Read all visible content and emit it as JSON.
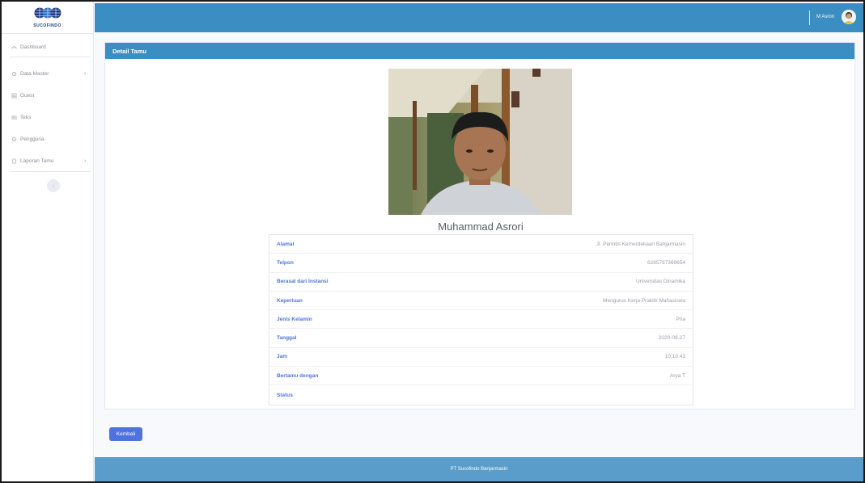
{
  "brand": {
    "logo_text": "SUCOFINDO"
  },
  "sidebar": {
    "items": [
      {
        "label": "Dashboard",
        "icon": "gauge-icon"
      },
      {
        "label": "Data Master",
        "icon": "cog-icon",
        "has_submenu": true
      },
      {
        "label": "Guest",
        "icon": "table-icon"
      },
      {
        "label": "Teks",
        "icon": "table-icon"
      },
      {
        "label": "Pengguna",
        "icon": "cog-icon"
      },
      {
        "label": "Laporan Tamu",
        "icon": "file-icon",
        "has_submenu": true
      }
    ],
    "chevron": "›",
    "toggle_glyph": "‹"
  },
  "topbar": {
    "user_name": "M Asrori"
  },
  "card": {
    "title": "Detail Tamu"
  },
  "guest": {
    "name": "Muhammad Asrori",
    "details": [
      {
        "label": "Alamat",
        "value": "Jl. Perintis Kemerdekaan Banjarmasin"
      },
      {
        "label": "Telpon",
        "value": "6285787369654"
      },
      {
        "label": "Berasal dari Instansi",
        "value": "Universitas Dinamika"
      },
      {
        "label": "Keperluan",
        "value": "Mengurus Kerja Praktik Mahasiswa"
      },
      {
        "label": "Jenis Kelamin",
        "value": "Pria"
      },
      {
        "label": "Tanggal",
        "value": "2020-09-27"
      },
      {
        "label": "Jam",
        "value": "10:10:43"
      },
      {
        "label": "Bertamu dengan",
        "value": "Arya T"
      },
      {
        "label": "Status",
        "value": ""
      }
    ]
  },
  "actions": {
    "back_label": "Kembali"
  },
  "footer": {
    "text": "PT Sucofindo Banjarmasin"
  },
  "colors": {
    "primary": "#4e73df",
    "header": "#3a8ec2",
    "footer": "#5a9cca"
  }
}
